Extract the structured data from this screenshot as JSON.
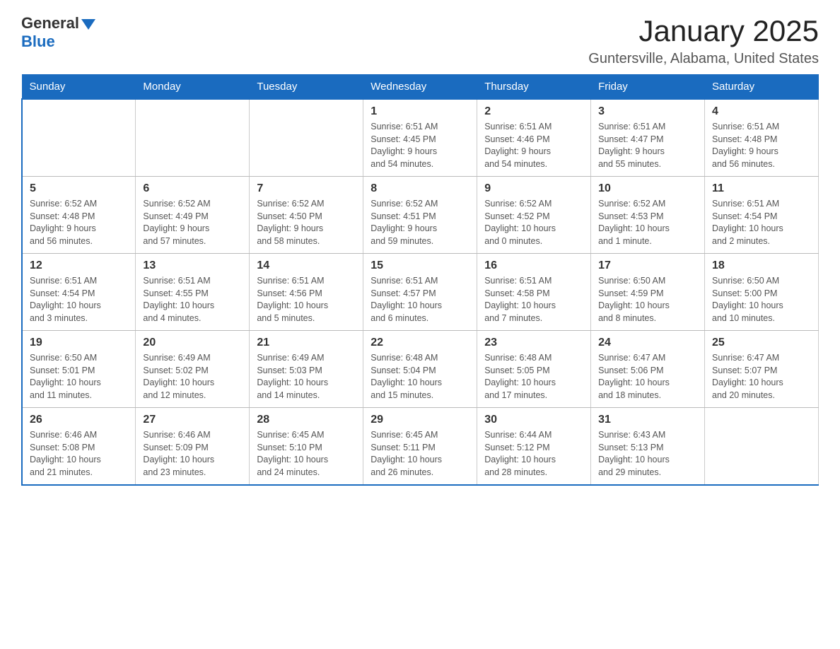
{
  "header": {
    "logo_general": "General",
    "logo_blue": "Blue",
    "title": "January 2025",
    "subtitle": "Guntersville, Alabama, United States"
  },
  "days_of_week": [
    "Sunday",
    "Monday",
    "Tuesday",
    "Wednesday",
    "Thursday",
    "Friday",
    "Saturday"
  ],
  "weeks": [
    [
      {
        "day": "",
        "info": ""
      },
      {
        "day": "",
        "info": ""
      },
      {
        "day": "",
        "info": ""
      },
      {
        "day": "1",
        "info": "Sunrise: 6:51 AM\nSunset: 4:45 PM\nDaylight: 9 hours\nand 54 minutes."
      },
      {
        "day": "2",
        "info": "Sunrise: 6:51 AM\nSunset: 4:46 PM\nDaylight: 9 hours\nand 54 minutes."
      },
      {
        "day": "3",
        "info": "Sunrise: 6:51 AM\nSunset: 4:47 PM\nDaylight: 9 hours\nand 55 minutes."
      },
      {
        "day": "4",
        "info": "Sunrise: 6:51 AM\nSunset: 4:48 PM\nDaylight: 9 hours\nand 56 minutes."
      }
    ],
    [
      {
        "day": "5",
        "info": "Sunrise: 6:52 AM\nSunset: 4:48 PM\nDaylight: 9 hours\nand 56 minutes."
      },
      {
        "day": "6",
        "info": "Sunrise: 6:52 AM\nSunset: 4:49 PM\nDaylight: 9 hours\nand 57 minutes."
      },
      {
        "day": "7",
        "info": "Sunrise: 6:52 AM\nSunset: 4:50 PM\nDaylight: 9 hours\nand 58 minutes."
      },
      {
        "day": "8",
        "info": "Sunrise: 6:52 AM\nSunset: 4:51 PM\nDaylight: 9 hours\nand 59 minutes."
      },
      {
        "day": "9",
        "info": "Sunrise: 6:52 AM\nSunset: 4:52 PM\nDaylight: 10 hours\nand 0 minutes."
      },
      {
        "day": "10",
        "info": "Sunrise: 6:52 AM\nSunset: 4:53 PM\nDaylight: 10 hours\nand 1 minute."
      },
      {
        "day": "11",
        "info": "Sunrise: 6:51 AM\nSunset: 4:54 PM\nDaylight: 10 hours\nand 2 minutes."
      }
    ],
    [
      {
        "day": "12",
        "info": "Sunrise: 6:51 AM\nSunset: 4:54 PM\nDaylight: 10 hours\nand 3 minutes."
      },
      {
        "day": "13",
        "info": "Sunrise: 6:51 AM\nSunset: 4:55 PM\nDaylight: 10 hours\nand 4 minutes."
      },
      {
        "day": "14",
        "info": "Sunrise: 6:51 AM\nSunset: 4:56 PM\nDaylight: 10 hours\nand 5 minutes."
      },
      {
        "day": "15",
        "info": "Sunrise: 6:51 AM\nSunset: 4:57 PM\nDaylight: 10 hours\nand 6 minutes."
      },
      {
        "day": "16",
        "info": "Sunrise: 6:51 AM\nSunset: 4:58 PM\nDaylight: 10 hours\nand 7 minutes."
      },
      {
        "day": "17",
        "info": "Sunrise: 6:50 AM\nSunset: 4:59 PM\nDaylight: 10 hours\nand 8 minutes."
      },
      {
        "day": "18",
        "info": "Sunrise: 6:50 AM\nSunset: 5:00 PM\nDaylight: 10 hours\nand 10 minutes."
      }
    ],
    [
      {
        "day": "19",
        "info": "Sunrise: 6:50 AM\nSunset: 5:01 PM\nDaylight: 10 hours\nand 11 minutes."
      },
      {
        "day": "20",
        "info": "Sunrise: 6:49 AM\nSunset: 5:02 PM\nDaylight: 10 hours\nand 12 minutes."
      },
      {
        "day": "21",
        "info": "Sunrise: 6:49 AM\nSunset: 5:03 PM\nDaylight: 10 hours\nand 14 minutes."
      },
      {
        "day": "22",
        "info": "Sunrise: 6:48 AM\nSunset: 5:04 PM\nDaylight: 10 hours\nand 15 minutes."
      },
      {
        "day": "23",
        "info": "Sunrise: 6:48 AM\nSunset: 5:05 PM\nDaylight: 10 hours\nand 17 minutes."
      },
      {
        "day": "24",
        "info": "Sunrise: 6:47 AM\nSunset: 5:06 PM\nDaylight: 10 hours\nand 18 minutes."
      },
      {
        "day": "25",
        "info": "Sunrise: 6:47 AM\nSunset: 5:07 PM\nDaylight: 10 hours\nand 20 minutes."
      }
    ],
    [
      {
        "day": "26",
        "info": "Sunrise: 6:46 AM\nSunset: 5:08 PM\nDaylight: 10 hours\nand 21 minutes."
      },
      {
        "day": "27",
        "info": "Sunrise: 6:46 AM\nSunset: 5:09 PM\nDaylight: 10 hours\nand 23 minutes."
      },
      {
        "day": "28",
        "info": "Sunrise: 6:45 AM\nSunset: 5:10 PM\nDaylight: 10 hours\nand 24 minutes."
      },
      {
        "day": "29",
        "info": "Sunrise: 6:45 AM\nSunset: 5:11 PM\nDaylight: 10 hours\nand 26 minutes."
      },
      {
        "day": "30",
        "info": "Sunrise: 6:44 AM\nSunset: 5:12 PM\nDaylight: 10 hours\nand 28 minutes."
      },
      {
        "day": "31",
        "info": "Sunrise: 6:43 AM\nSunset: 5:13 PM\nDaylight: 10 hours\nand 29 minutes."
      },
      {
        "day": "",
        "info": ""
      }
    ]
  ]
}
